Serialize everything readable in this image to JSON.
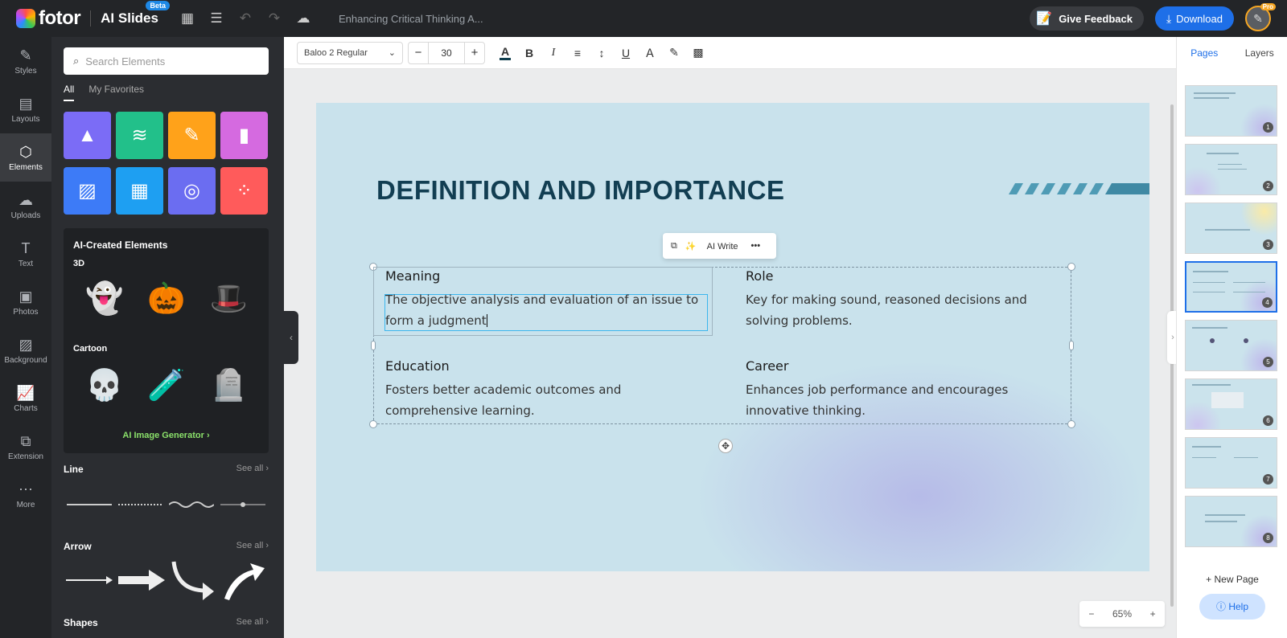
{
  "app": {
    "brand": "fotor",
    "product": "AI Slides",
    "badge": "Beta",
    "doc_title": "Enhancing Critical Thinking A...",
    "feedback_label": "Give Feedback",
    "download_label": "Download",
    "pro_badge": "Pro"
  },
  "rail": [
    {
      "label": "Styles",
      "icon": "styles-icon"
    },
    {
      "label": "Layouts",
      "icon": "layouts-icon"
    },
    {
      "label": "Elements",
      "icon": "elements-icon",
      "active": true
    },
    {
      "label": "Uploads",
      "icon": "upload-icon"
    },
    {
      "label": "Text",
      "icon": "text-icon"
    },
    {
      "label": "Photos",
      "icon": "photos-icon"
    },
    {
      "label": "Background",
      "icon": "background-icon"
    },
    {
      "label": "Charts",
      "icon": "charts-icon"
    },
    {
      "label": "Extension",
      "icon": "extension-icon"
    },
    {
      "label": "More",
      "icon": "more-icon"
    }
  ],
  "panel": {
    "search_placeholder": "Search Elements",
    "tabs": [
      "All",
      "My Favorites"
    ],
    "tiles": [
      {
        "name": "shapes",
        "color": "#7b6cf6"
      },
      {
        "name": "text-styles",
        "color": "#22c08a"
      },
      {
        "name": "brush",
        "color": "#ffa21a"
      },
      {
        "name": "icons",
        "color": "#d56ae0"
      },
      {
        "name": "images",
        "color": "#3d7bf7"
      },
      {
        "name": "frames",
        "color": "#1e9ff2"
      },
      {
        "name": "masks",
        "color": "#6b6df1"
      },
      {
        "name": "patterns",
        "color": "#ff5b5b"
      }
    ],
    "ai_title": "AI-Created Elements",
    "ai_3d": "3D",
    "ai_cartoon": "Cartoon",
    "ai_generator": "AI Image Generator",
    "line_title": "Line",
    "arrow_title": "Arrow",
    "shapes_title": "Shapes",
    "see_all": "See all"
  },
  "toolbar": {
    "font": "Baloo 2 Regular",
    "size": "30"
  },
  "slide": {
    "title": "DEFINITION AND IMPORTANCE",
    "ai_write": "AI Write",
    "items": [
      {
        "heading": "Meaning",
        "body": "The objective analysis and evaluation of an issue to form a judgment"
      },
      {
        "heading": "Role",
        "body": "Key for making sound, reasoned decisions and solving problems."
      },
      {
        "heading": "Education",
        "body": "Fosters better academic outcomes and comprehensive learning."
      },
      {
        "heading": "Career",
        "body": "Enhances job performance and encourages innovative thinking."
      }
    ]
  },
  "zoom": {
    "value": "65%"
  },
  "pages": {
    "tabs": [
      "Pages",
      "Layers"
    ],
    "thumbs": [
      "1",
      "2",
      "3",
      "4",
      "5",
      "6",
      "7",
      "8"
    ],
    "active": "4",
    "new_page": "New Page",
    "help": "Help"
  }
}
